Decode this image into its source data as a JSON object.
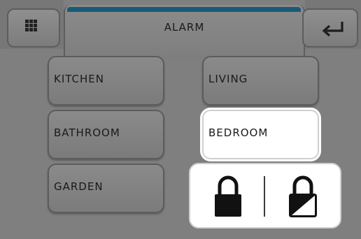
{
  "header": {
    "title": "ALARM",
    "menu_icon": "grid-icon",
    "back_icon": "return-arrow-icon"
  },
  "rooms": [
    {
      "label": "KITCHEN",
      "selected": false
    },
    {
      "label": "LIVING",
      "selected": false
    },
    {
      "label": "BATHROOM",
      "selected": false
    },
    {
      "label": "BEDROOM",
      "selected": true
    },
    {
      "label": "GARDEN",
      "selected": false
    }
  ],
  "lock_panel": {
    "options": [
      {
        "icon": "lock-closed-icon"
      },
      {
        "icon": "lock-partial-icon"
      }
    ]
  },
  "colors": {
    "background": "#7f7f7f",
    "accent": "#1a5a78",
    "selected": "#ffffff",
    "text": "#1a1a1a"
  }
}
